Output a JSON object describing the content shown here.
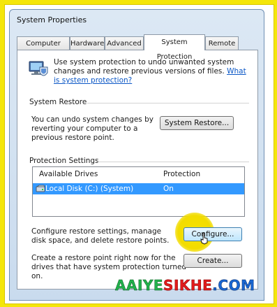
{
  "window": {
    "title": "System Properties"
  },
  "tabs": [
    {
      "label": "Computer Name"
    },
    {
      "label": "Hardware"
    },
    {
      "label": "Advanced"
    },
    {
      "label": "System Protection"
    },
    {
      "label": "Remote"
    }
  ],
  "active_tab": "System Protection",
  "intro": {
    "text": "Use system protection to undo unwanted system changes and restore previous versions of files.",
    "link": "What is system protection?"
  },
  "system_restore": {
    "label": "System Restore",
    "description": "You can undo system changes by reverting your computer to a previous restore point.",
    "button": "System Restore..."
  },
  "protection_settings": {
    "label": "Protection Settings",
    "columns": [
      "Available Drives",
      "Protection"
    ],
    "rows": [
      {
        "drive": "Local Disk (C:) (System)",
        "protection": "On",
        "selected": true
      }
    ],
    "configure_text": "Configure restore settings, manage disk space, and delete restore points.",
    "configure_button": "Configure...",
    "create_text": "Create a restore point right now for the drives that have system protection turned on.",
    "create_button": "Create..."
  },
  "watermark": {
    "part1": "AAIYE",
    "part2": "SIKHE",
    "part3": ".COM"
  },
  "colors": {
    "frame": "#f4e60a",
    "selection": "#3399ff",
    "link": "#0b57c6"
  }
}
